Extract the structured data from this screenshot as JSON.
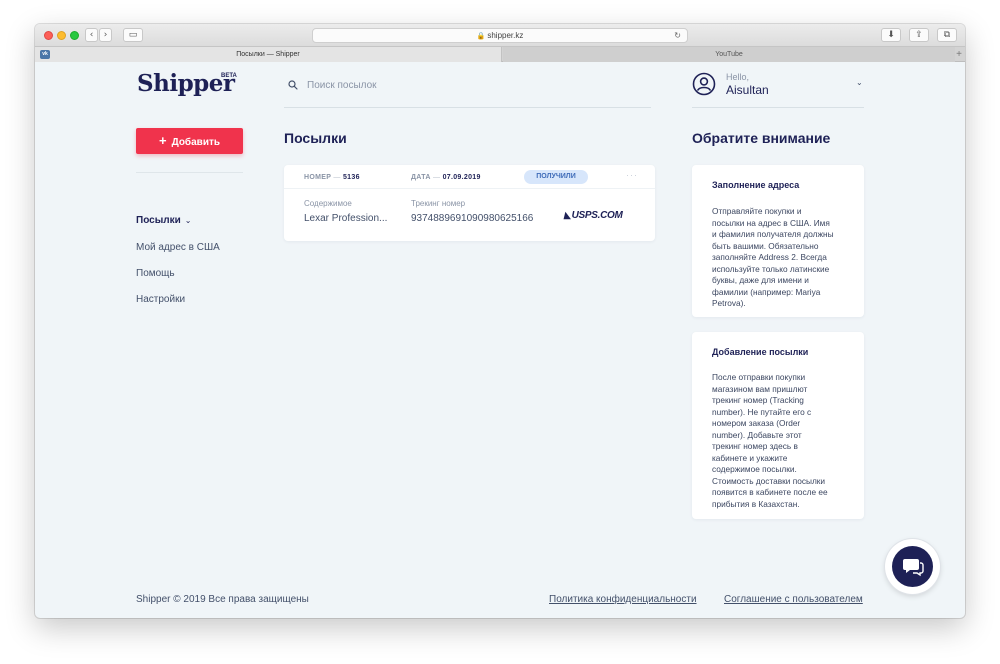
{
  "browser": {
    "address": "shipper.kz",
    "tabs": [
      {
        "label": "Посылки — Shipper",
        "icon": "vk-icon"
      },
      {
        "label": "YouTube"
      }
    ]
  },
  "logo": {
    "text": "Shipper",
    "badge": "BETA"
  },
  "sidebar": {
    "add_button": "Добавить",
    "items": [
      {
        "label": "Посылки",
        "active": true
      },
      {
        "label": "Мой адрес в США"
      },
      {
        "label": "Помощь"
      },
      {
        "label": "Настройки"
      }
    ]
  },
  "search": {
    "placeholder": "Поиск посылок"
  },
  "main": {
    "title": "Посылки",
    "parcels": [
      {
        "number_label": "НОМЕР",
        "number": "5136",
        "date_label": "ДАТА",
        "date": "07.09.2019",
        "status": "ПОЛУЧИЛИ",
        "content_label": "Содержимое",
        "content": "Lexar Profession...",
        "tracking_label": "Трекинг номер",
        "tracking": "9374889691090980625166",
        "carrier": "USPS.COM"
      }
    ]
  },
  "user": {
    "greeting": "Hello,",
    "name": "Aisultan"
  },
  "notes": {
    "title": "Обратите внимание",
    "cards": [
      {
        "title": "Заполнение адреса",
        "lines": [
          "Отправляйте покупки и",
          "посылки на адрес в США. Имя",
          "и фамилия получателя должны",
          "быть вашими. Обязательно",
          "заполняйте Address 2. Всегда",
          "используйте только латинские",
          "буквы, даже для имени и",
          "фамилии (например: Mariya",
          "Petrova)."
        ]
      },
      {
        "title": "Добавление посылки",
        "lines": [
          "После отправки покупки",
          "магазином вам пришлют",
          "трекинг номер (Tracking",
          "number). Не путайте его с",
          "номером заказа (Order",
          "number). Добавьте этот",
          "трекинг номер здесь в",
          "кабинете и укажите",
          "содержимое посылки.",
          "Стоимость доставки посылки",
          "появится в кабинете после ее",
          "прибытия в Казахстан."
        ]
      }
    ]
  },
  "footer": {
    "copyright": "Shipper © 2019 Все права защищены",
    "privacy": "Политика конфиденциальности",
    "terms": "Соглашение с пользователем"
  },
  "colors": {
    "accent": "#f0334c",
    "brand": "#1e2156",
    "badge": "#d7e6fb"
  }
}
